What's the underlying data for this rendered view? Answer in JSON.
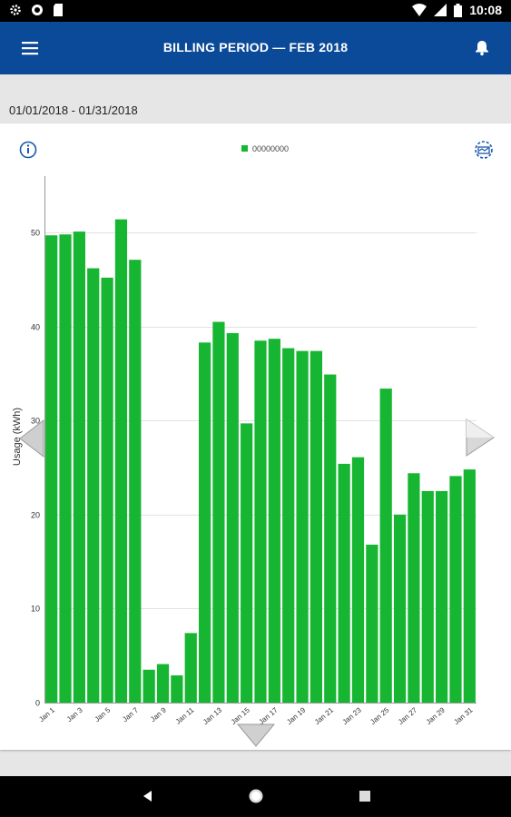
{
  "status_bar": {
    "time": "10:08"
  },
  "app_bar": {
    "title": "BILLING PERIOD  —  FEB 2018",
    "menu_icon": "menu-icon",
    "bell_icon": "bell-icon"
  },
  "billing": {
    "date_range": "01/01/2018 - 01/31/2018"
  },
  "colors": {
    "app_bar": "#0b4a98",
    "bar": "#17b632",
    "status_bar": "#000000",
    "nav_bar": "#000000"
  },
  "chart_data": {
    "type": "bar",
    "ylabel": "Usage (kWh)",
    "xlabel": "",
    "ylim": [
      0,
      56
    ],
    "yticks": [
      0,
      10,
      20,
      30,
      40,
      50
    ],
    "grid": true,
    "legend": {
      "label": "00000000",
      "position": "top-center"
    },
    "categories": [
      "Jan 1",
      "Jan 2",
      "Jan 3",
      "Jan 4",
      "Jan 5",
      "Jan 6",
      "Jan 7",
      "Jan 8",
      "Jan 9",
      "Jan 10",
      "Jan 11",
      "Jan 12",
      "Jan 13",
      "Jan 14",
      "Jan 15",
      "Jan 16",
      "Jan 17",
      "Jan 18",
      "Jan 19",
      "Jan 20",
      "Jan 21",
      "Jan 22",
      "Jan 23",
      "Jan 24",
      "Jan 25",
      "Jan 26",
      "Jan 27",
      "Jan 28",
      "Jan 29",
      "Jan 30",
      "Jan 31"
    ],
    "tick_labels": [
      "Jan 1",
      "Jan 3",
      "Jan 5",
      "Jan 7",
      "Jan 9",
      "Jan 11",
      "Jan 13",
      "Jan 15",
      "Jan 17",
      "Jan 19",
      "Jan 21",
      "Jan 23",
      "Jan 25",
      "Jan 27",
      "Jan 29",
      "Jan 31"
    ],
    "series": [
      {
        "name": "00000000",
        "values": [
          49.7,
          49.8,
          50.1,
          46.2,
          45.2,
          51.4,
          47.1,
          3.5,
          4.1,
          2.9,
          7.4,
          38.3,
          40.5,
          39.3,
          29.7,
          38.5,
          38.7,
          37.7,
          37.4,
          37.4,
          34.9,
          25.4,
          26.1,
          16.8,
          33.4,
          20.0,
          24.4,
          22.5,
          22.5,
          24.1,
          24.8
        ]
      }
    ]
  }
}
